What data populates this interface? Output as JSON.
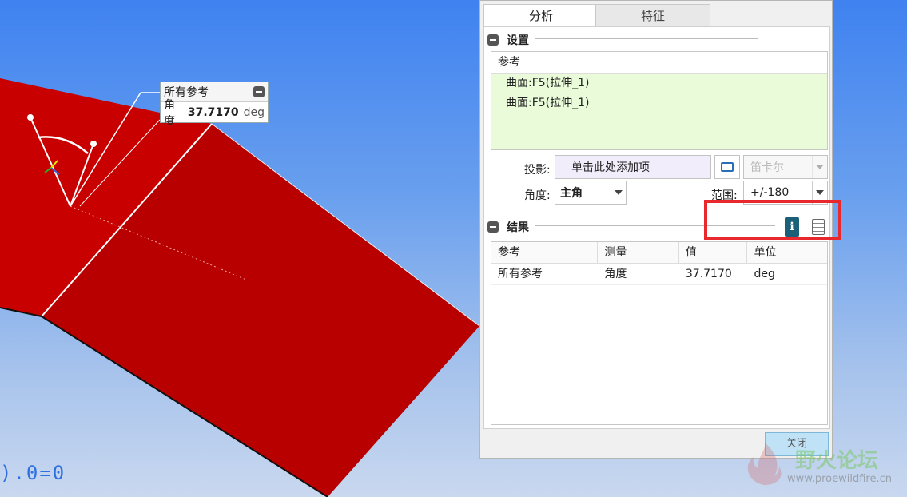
{
  "annotation": {
    "title": "所有参考",
    "row_label": "角度",
    "row_value": "37.7170",
    "row_unit": "deg"
  },
  "coord_readout": ").0=0",
  "dialog": {
    "tabs": [
      {
        "label": "分析",
        "active": true
      },
      {
        "label": "特征",
        "active": false
      }
    ],
    "settings": {
      "title": "设置",
      "ref_header": "参考",
      "refs": [
        "曲面:F5(拉伸_1)",
        "曲面:F5(拉伸_1)"
      ],
      "projection_label": "投影:",
      "projection_placeholder": "单击此处添加项",
      "cartesian": "笛卡尔",
      "angle_label": "角度:",
      "angle_value": "主角",
      "range_label": "范围:",
      "range_value": "+/-180"
    },
    "results": {
      "title": "结果",
      "columns": [
        "参考",
        "测量",
        "值",
        "单位"
      ],
      "rows": [
        [
          "所有参考",
          "角度",
          "37.7170",
          "deg"
        ]
      ]
    },
    "close_label": "关闭"
  },
  "watermark": {
    "text": "野火论坛",
    "url": "www.proewildfire.cn"
  },
  "colors": {
    "surface_red": "#c90000",
    "surface_dark_red": "#b80000",
    "highlight_red": "#e8282c",
    "list_green": "#e9fbd9"
  }
}
